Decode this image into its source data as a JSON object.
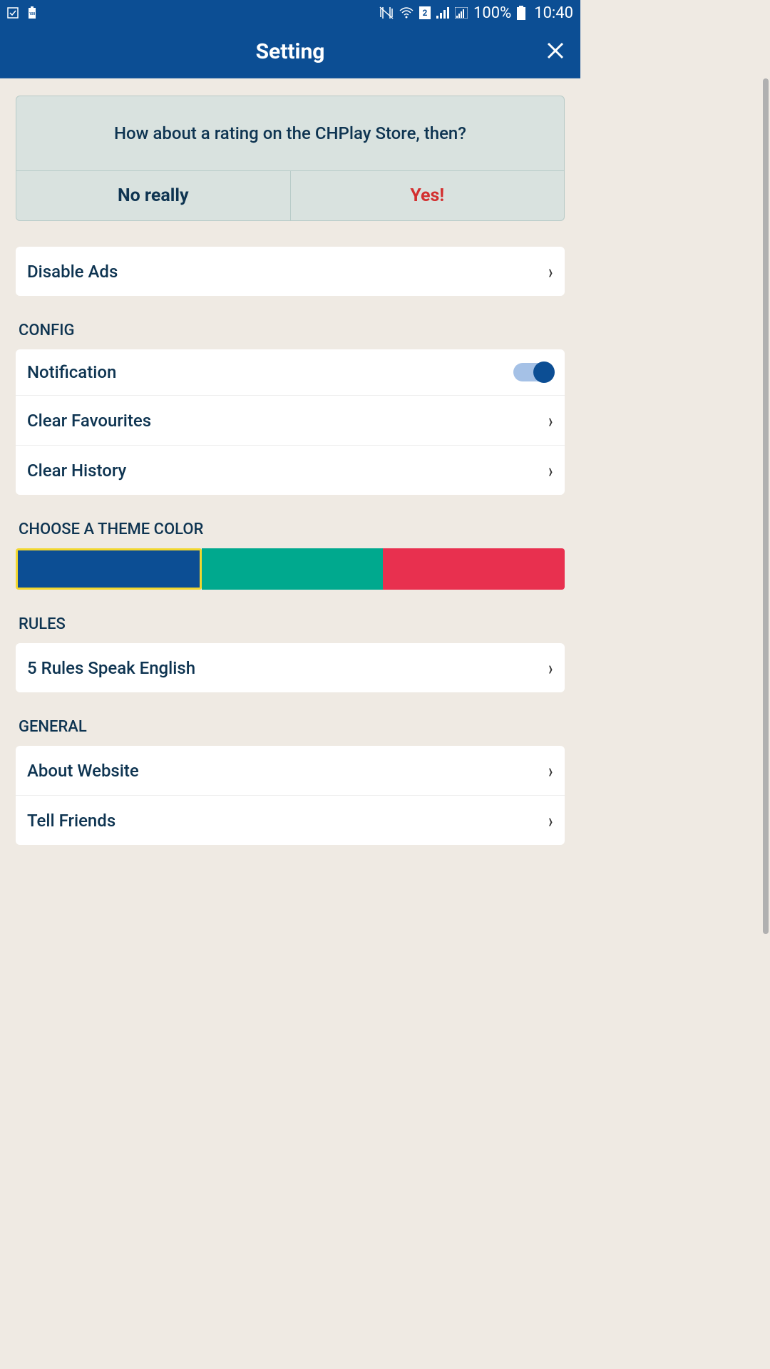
{
  "status": {
    "battery": "100%",
    "time": "10:40",
    "sim": "2"
  },
  "header": {
    "title": "Setting"
  },
  "rating": {
    "prompt": "How about a rating on the CHPlay Store, then?",
    "noLabel": "No really",
    "yesLabel": "Yes!"
  },
  "disableAds": {
    "label": "Disable Ads"
  },
  "config": {
    "sectionLabel": "CONFIG",
    "notification": "Notification",
    "clearFavourites": "Clear Favourites",
    "clearHistory": "Clear History"
  },
  "theme": {
    "sectionLabel": "CHOOSE A THEME COLOR",
    "colors": {
      "blue": "#0c4e94",
      "teal": "#00a98e",
      "red": "#e8304f"
    }
  },
  "rules": {
    "sectionLabel": "RULES",
    "item": "5 Rules Speak English"
  },
  "general": {
    "sectionLabel": "GENERAL",
    "aboutWebsite": "About Website",
    "tellFriends": "Tell Friends"
  }
}
